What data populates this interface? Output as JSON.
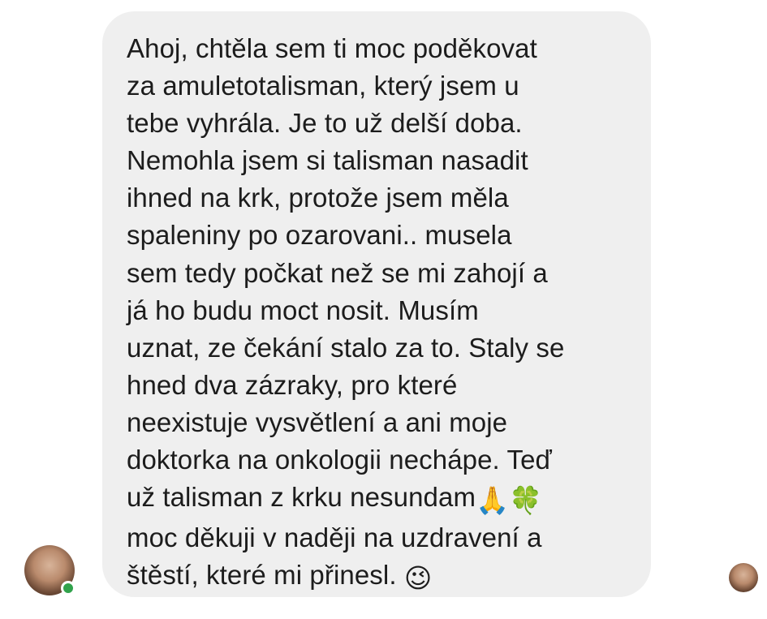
{
  "message": {
    "lines": [
      "Ahoj, chtěla sem ti moc poděkovat",
      "za amuletotalisman, který jsem u",
      "tebe vyhrála. Je to už delší doba.",
      "Nemohla jsem si talisman nasadit",
      "ihned na krk, protože jsem měla",
      "spaleniny po ozarovani.. musela",
      "sem tedy počkat než se mi zahojí a",
      "já ho budu moct nosit. Musím",
      "uznat, ze čekání stalo za to. Staly se",
      "hned dva zázraky, pro které",
      "neexistuje vysvětlení a ani moje",
      "doktorka na onkologii nechápe. Teď",
      "už talisman z krku nesundam",
      "moc děkuji v naději na uzdravení a",
      "štěstí, které mi přinesl."
    ],
    "emoji_after_line_13": "🙏🍀",
    "emoji_after_line_15": "😉"
  },
  "sender": {
    "online": true,
    "online_color": "#31a24c"
  },
  "colors": {
    "bubble": "#efefef",
    "text": "#1c1c1c",
    "background": "#ffffff"
  }
}
